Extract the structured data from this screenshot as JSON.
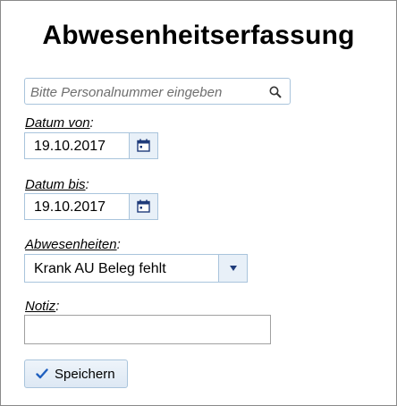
{
  "header": {
    "title": "Abwesenheitserfassung"
  },
  "search": {
    "placeholder": "Bitte Personalnummer eingeben",
    "icon": "search-icon"
  },
  "date_from": {
    "label": "Datum von",
    "suffix": ":",
    "value": "19.10.2017",
    "icon": "calendar-icon"
  },
  "date_to": {
    "label": "Datum bis",
    "suffix": ":",
    "value": "19.10.2017",
    "icon": "calendar-icon"
  },
  "absence": {
    "label": "Abwesenheiten",
    "suffix": ":",
    "value": "Krank AU Beleg fehlt",
    "icon": "chevron-down-icon"
  },
  "note": {
    "label": "Notiz",
    "suffix": ":",
    "value": ""
  },
  "save_button": {
    "label": "Speichern",
    "icon": "check-icon"
  },
  "colors": {
    "accent": "#1f5fbf",
    "field_border": "#a9c4dc",
    "button_bg": "#e8f0f8"
  }
}
